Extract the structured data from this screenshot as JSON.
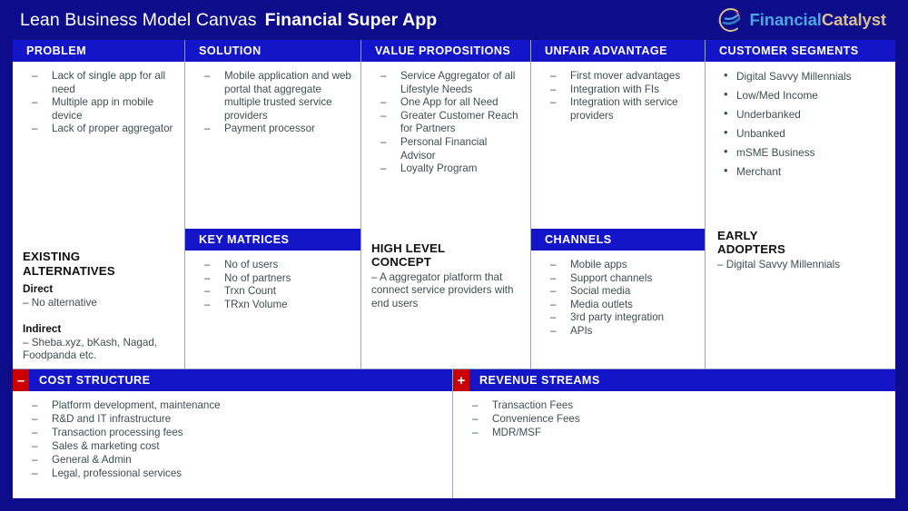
{
  "header": {
    "title_light": "Lean Business Model Canvas",
    "title_bold": "Financial Super App",
    "brand": {
      "icon": "financial-catalyst-swoosh-icon",
      "name_part1": "Financial",
      "name_part2": "Catalyst",
      "color_part1": "#4aa8e0",
      "color_part2": "#d9bd92"
    }
  },
  "colors": {
    "frame_navy": "#0d0d8c",
    "header_blue": "#1414c8",
    "sign_red": "#cc0000",
    "body_text": "#3d4e52",
    "divider": "#9aa3c4"
  },
  "columns": {
    "problem": {
      "header": "PROBLEM",
      "items": [
        "Lack of single app for all need",
        "Multiple app in mobile device",
        "Lack of proper aggregator"
      ],
      "existing_alternatives": {
        "title": "EXISTING\nALTERNATIVES",
        "direct_label": "Direct",
        "direct_text": "– No alternative",
        "indirect_label": "Indirect",
        "indirect_text": "– Sheba.xyz, bKash, Nagad, Foodpanda etc."
      }
    },
    "solution": {
      "header": "SOLUTION",
      "items": [
        "Mobile application and web portal that aggregate multiple trusted service providers",
        "Payment processor"
      ],
      "key_matrices": {
        "header": "KEY MATRICES",
        "items": [
          "No of users",
          "No of partners",
          "Trxn Count",
          "TRxn Volume"
        ]
      }
    },
    "value_propositions": {
      "header": "VALUE PROPOSITIONS",
      "items": [
        "Service Aggregator of all Lifestyle Needs",
        "One App for all Need",
        "Greater Customer Reach for Partners",
        "Personal Financial Advisor",
        "Loyalty Program"
      ],
      "high_level_concept": {
        "title": "HIGH LEVEL\nCONCEPT",
        "text": "– A aggregator platform that connect service providers with end users"
      }
    },
    "unfair_advantage": {
      "header": "UNFAIR ADVANTAGE",
      "items": [
        "First mover advantages",
        "Integration with FIs",
        "Integration with service providers"
      ],
      "channels": {
        "header": "CHANNELS",
        "items": [
          "Mobile apps",
          "Support channels",
          "Social media",
          "Media outlets",
          "3rd party integration",
          "APIs"
        ]
      }
    },
    "customer_segments": {
      "header": "CUSTOMER SEGMENTS",
      "items": [
        "Digital Savvy Millennials",
        "Low/Med Income",
        "Underbanked",
        "Unbanked",
        "mSME Business",
        "Merchant"
      ],
      "early_adopters": {
        "title": "EARLY\nADOPTERS",
        "text": "– Digital Savvy Millennials"
      }
    }
  },
  "bottom": {
    "cost_structure": {
      "sign": "–",
      "sign_name": "minus-sign-icon",
      "header": "COST STRUCTURE",
      "items": [
        "Platform development, maintenance",
        "R&D and IT infrastructure",
        "Transaction processing fees",
        "Sales & marketing cost",
        "General & Admin",
        "Legal, professional services"
      ]
    },
    "revenue_streams": {
      "sign": "+",
      "sign_name": "plus-sign-icon",
      "header": "REVENUE STREAMS",
      "items": [
        "Transaction Fees",
        "Convenience Fees",
        "MDR/MSF"
      ]
    }
  }
}
